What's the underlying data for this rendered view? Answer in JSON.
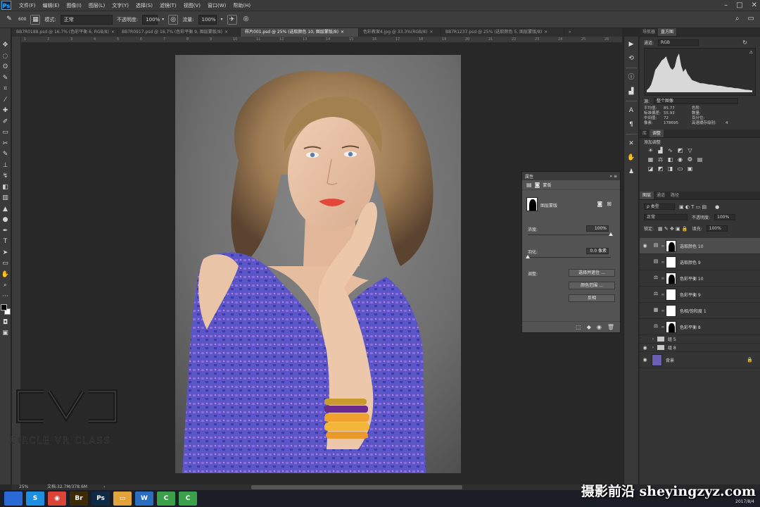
{
  "menubar": {
    "app_logo": "Ps",
    "items": [
      "文件(F)",
      "编辑(E)",
      "图像(I)",
      "图层(L)",
      "文字(Y)",
      "选择(S)",
      "滤镜(T)",
      "视图(V)",
      "窗口(W)",
      "帮助(H)"
    ]
  },
  "options": {
    "brush_size": "600",
    "mode_label": "模式:",
    "mode_value": "正常",
    "opacity_label": "不透明度:",
    "opacity_value": "100%",
    "flow_label": "流量:",
    "flow_value": "100%"
  },
  "tabs": [
    {
      "label": "BB7R0188.psd @ 16.7% (色彩平衡 6, RGB/8)",
      "active": false
    },
    {
      "label": "BB7R0917.psd @ 16.7% (色彩平衡 9, 图层蒙版/8)",
      "active": false
    },
    {
      "label": "样片001.psd @ 25% (选取颜色 10, 图层蒙版/8)",
      "active": true
    },
    {
      "label": "色彩教案4.jpg @ 33.3%(RGB/8)",
      "active": false
    },
    {
      "label": "BB7R1237.psd @ 25% (选取颜色 5, 图层蒙版/8)",
      "active": false
    }
  ],
  "ruler_ticks": [
    "1",
    "2",
    "3",
    "4",
    "5",
    "6",
    "7",
    "8",
    "9",
    "10",
    "11",
    "12",
    "13",
    "14",
    "15",
    "16",
    "17",
    "18",
    "19",
    "20",
    "21",
    "22",
    "23",
    "24",
    "25",
    "26"
  ],
  "histogram": {
    "tabs": [
      "导航器",
      "直方图"
    ],
    "channel_label": "通道:",
    "channel_value": "RGB",
    "source_label": "源:",
    "source_value": "整个图像",
    "stats": {
      "mean_label": "平均值:",
      "mean": "85.77",
      "stddev_label": "标准偏差:",
      "stddev": "55.93",
      "median_label": "中间值:",
      "median": "72",
      "pixels_label": "像素:",
      "pixels": "178695",
      "level_label": "色阶:",
      "count_label": "数量:",
      "percentile_label": "百分位:",
      "cache_label": "高速缓存级别:",
      "cache": "4"
    },
    "levels": [
      0.05,
      0.1,
      0.18,
      0.35,
      0.55,
      0.62,
      0.7,
      0.78,
      0.82,
      0.88,
      0.72,
      0.6,
      0.55,
      0.62,
      0.85,
      0.95,
      0.65,
      0.5,
      0.58,
      0.45,
      0.38,
      0.3,
      0.28,
      0.26,
      0.24,
      0.22,
      0.22,
      0.21,
      0.2,
      0.19,
      0.19,
      0.18,
      0.17,
      0.16,
      0.16,
      0.15,
      0.14,
      0.13,
      0.12,
      0.12,
      0.11,
      0.1,
      0.1,
      0.09,
      0.08,
      0.07,
      0.06,
      0.06,
      0.05,
      0.05
    ]
  },
  "adjustments": {
    "tabs": [
      "库",
      "调整"
    ],
    "add_label": "添加调整"
  },
  "layers_panel": {
    "tabs": [
      "图层",
      "通道",
      "路径"
    ],
    "filter_value": "ρ 类型",
    "blend_value": "正常",
    "opacity_label": "不透明度:",
    "opacity_value": "100%",
    "lock_label": "锁定:",
    "fill_label": "填充:",
    "fill_value": "100%",
    "layers": [
      {
        "name": "选取颜色 10",
        "visible": true,
        "selected": true,
        "kind": "adj",
        "mask": "sil",
        "icon": "▤"
      },
      {
        "name": "选取颜色 9",
        "visible": false,
        "selected": false,
        "kind": "adj",
        "mask": "white",
        "icon": "▤"
      },
      {
        "name": "色彩平衡 10",
        "visible": false,
        "selected": false,
        "kind": "adj",
        "mask": "sil",
        "icon": "⚖"
      },
      {
        "name": "色彩平衡 9",
        "visible": false,
        "selected": false,
        "kind": "adj",
        "mask": "white",
        "icon": "⚖"
      },
      {
        "name": "色相/饱和度 1",
        "visible": false,
        "selected": false,
        "kind": "adj",
        "mask": "white",
        "icon": "▦"
      },
      {
        "name": "色彩平衡 8",
        "visible": false,
        "selected": false,
        "kind": "adj",
        "mask": "sil",
        "icon": "⚖"
      },
      {
        "name": "组 5",
        "visible": false,
        "selected": false,
        "kind": "group"
      },
      {
        "name": "组 8",
        "visible": true,
        "selected": false,
        "kind": "group"
      },
      {
        "name": "背景",
        "visible": true,
        "selected": false,
        "kind": "bg"
      }
    ]
  },
  "properties": {
    "title": "属性",
    "section": "蒙版",
    "mask_type": "图层蒙版",
    "density_label": "浓度:",
    "density_value": "100%",
    "density_level": 1.0,
    "feather_label": "羽化:",
    "feather_value": "0.0 像素",
    "feather_level": 0.0,
    "refine_label": "调整:",
    "buttons": [
      "选择并遮住 ...",
      "颜色范围 ...",
      "反相"
    ]
  },
  "status": {
    "zoom": "25%",
    "doc": "文档:32.7M/378.6M"
  },
  "watermark": {
    "logo_text": "CVC",
    "caption": "CIRCLE VR CLASS",
    "site": "摄影前沿 sheyingzyz.com"
  },
  "taskbar": {
    "apps": [
      {
        "label": "",
        "color": "#2a6ad6",
        "name": "start"
      },
      {
        "label": "S",
        "color": "#1e8fe0",
        "name": "app-swirl"
      },
      {
        "label": "◉",
        "color": "#db4437",
        "name": "chrome"
      },
      {
        "label": "Br",
        "color": "#3d2a06",
        "name": "bridge"
      },
      {
        "label": "Ps",
        "color": "#0e2a44",
        "name": "photoshop"
      },
      {
        "label": "▭",
        "color": "#e0a43a",
        "name": "explorer"
      },
      {
        "label": "W",
        "color": "#2b6dbf",
        "name": "word"
      },
      {
        "label": "C",
        "color": "#3aa04a",
        "name": "camtasia-1"
      },
      {
        "label": "C",
        "color": "#3aa04a",
        "name": "camtasia-2"
      }
    ],
    "clock_date": "2017/8/4"
  },
  "colors": {
    "accent": "#31a8ff",
    "panel": "#353535",
    "canvas_bg": "#282828"
  }
}
